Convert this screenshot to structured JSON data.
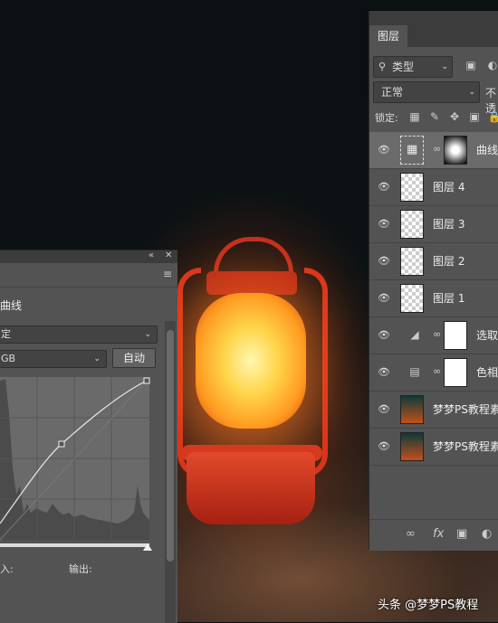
{
  "layers_panel": {
    "tab": "图层",
    "filter_label": "类型",
    "blend_mode": "正常",
    "opacity_label": "不透",
    "lock_label": "锁定:",
    "layers": [
      {
        "name": "曲线",
        "kind": "adjustment-curves",
        "selected": true
      },
      {
        "name": "图层 4",
        "kind": "pixel"
      },
      {
        "name": "图层 3",
        "kind": "pixel"
      },
      {
        "name": "图层 2",
        "kind": "pixel"
      },
      {
        "name": "图层 1",
        "kind": "pixel"
      },
      {
        "name": "选取",
        "kind": "adjustment-selective-color"
      },
      {
        "name": "色相",
        "kind": "adjustment-hue"
      },
      {
        "name": "梦梦PS教程素",
        "kind": "photo"
      },
      {
        "name": "梦梦PS教程素",
        "kind": "photo"
      }
    ],
    "footer_icons": [
      "link-icon",
      "fx-icon",
      "mask-icon",
      "adjustment-icon"
    ]
  },
  "properties_panel": {
    "title": "曲线",
    "preset_value": "定",
    "channel_value": "GB",
    "auto_button": "自动",
    "input_label": "入:",
    "output_label": "输出:"
  },
  "watermark": "头条 @梦梦PS教程",
  "colors": {
    "panel": "#535353",
    "panel_dark": "#3c3c3c",
    "lantern_red": "#d8341c",
    "glow": "#ffd54a"
  }
}
